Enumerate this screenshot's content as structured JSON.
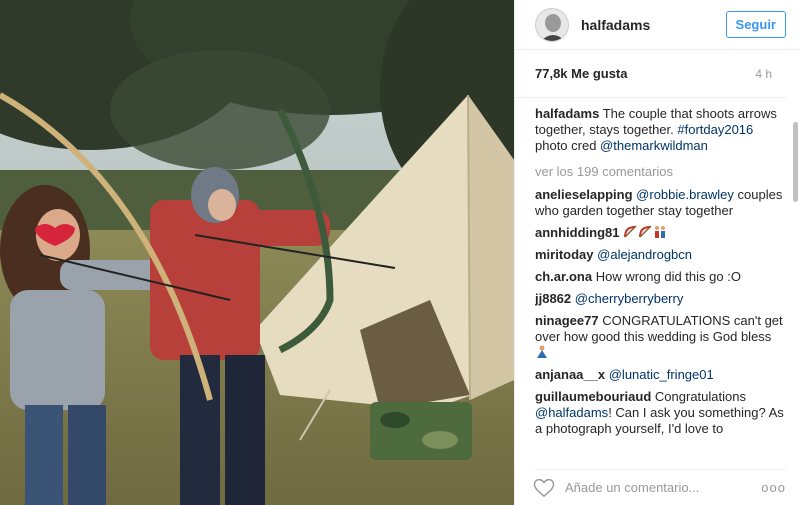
{
  "post": {
    "username": "halfadams",
    "follow_label": "Seguir",
    "likes": "77,8k Me gusta",
    "time": "4 h",
    "caption": {
      "user": "halfadams",
      "text": "The couple that shoots arrows together, stays together. ",
      "hashtag": "#fortday2016",
      "text2": " photo cred ",
      "mention": "@themarkwildman"
    },
    "view_comments": "ver los 199 comentarios",
    "comments": [
      {
        "user": "anelieselapping",
        "mention": "@robbie.brawley",
        "text": " couples who garden together stay together"
      },
      {
        "user": "annhidding81",
        "mention": "",
        "text": "",
        "emoji": [
          "bow-arrow-emoji",
          "bow-arrow-emoji",
          "couple-emoji"
        ]
      },
      {
        "user": "miritoday",
        "mention": "@alejandrogbcn",
        "text": ""
      },
      {
        "user": "ch.ar.ona",
        "mention": "",
        "text": "How wrong did this go :O"
      },
      {
        "user": "jj8862",
        "mention": "@cherryberryberry",
        "text": ""
      },
      {
        "user": "ninagee77",
        "mention": "",
        "text": "CONGRATULATIONS can't get over how good this wedding is God bless",
        "emoji": [
          "praying-emoji"
        ]
      },
      {
        "user": "anjanaa__x",
        "mention": "@lunatic_fringe01",
        "text": ""
      },
      {
        "user": "guillaumebouriaud",
        "mention": "",
        "text": "Congratulations",
        "mention2": "@halfadams",
        "text2": "! Can I ask you something? As a photograph yourself, I'd love to"
      }
    ],
    "comment_placeholder": "Añade un comentario...",
    "options_label": "ooo"
  },
  "colors": {
    "link": "#003569",
    "follow": "#3897f0",
    "muted": "#999999"
  }
}
